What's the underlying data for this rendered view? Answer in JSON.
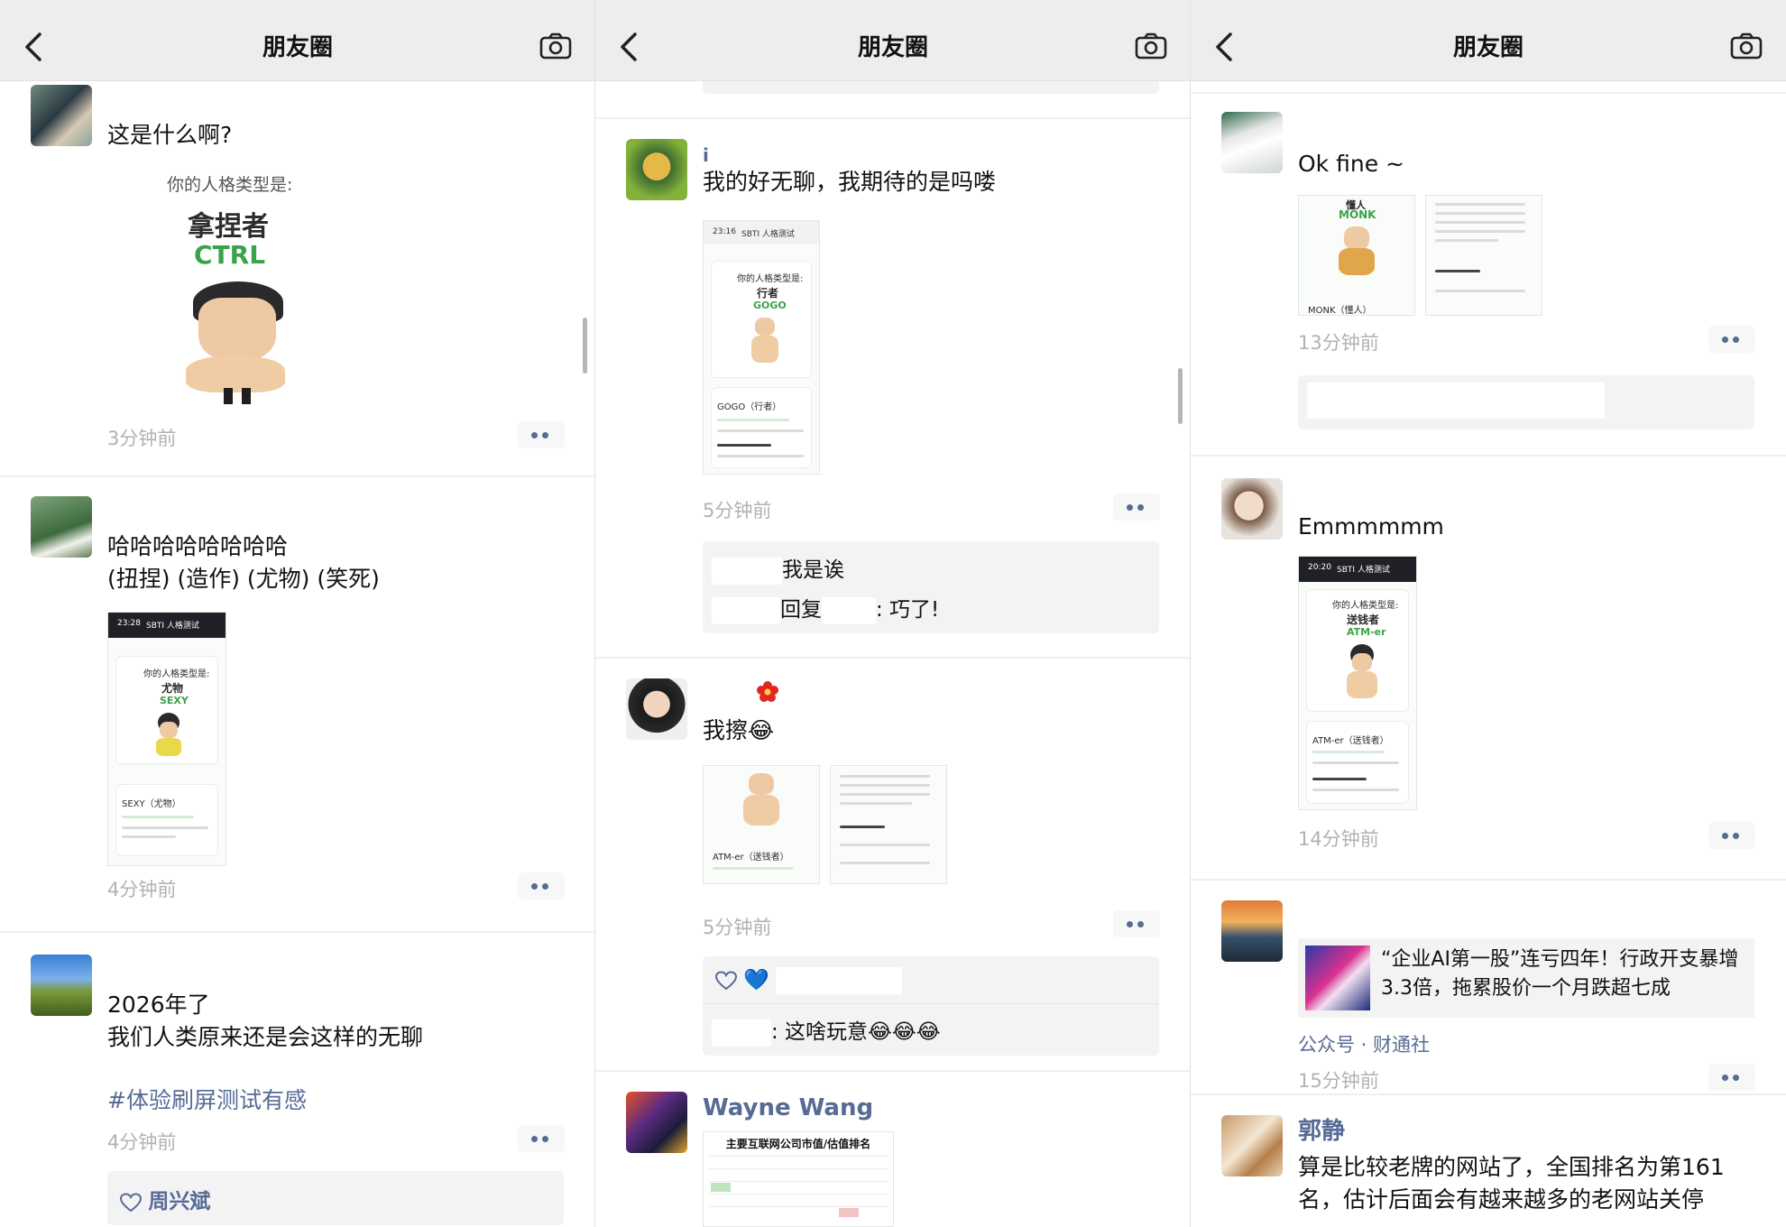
{
  "header": {
    "title": "朋友圈"
  },
  "panel1": {
    "post1": {
      "text": "这是什么啊?",
      "image_subtitle": "你的人格类型是:",
      "image_type_cn": "拿捏者",
      "image_type_en": "CTRL",
      "time": "3分钟前"
    },
    "post2": {
      "text_line1": "哈哈哈哈哈哈哈哈",
      "text_line2": "(扭捏) (造作) (尤物) (笑死)",
      "time": "4分钟前",
      "shot": {
        "status": "23:28",
        "title": "SBTI 人格测试",
        "subtitle": "你的人格类型是:",
        "type_cn": "尤物",
        "type_en": "SEXY",
        "result": "SEXY（尤物）"
      }
    },
    "post3": {
      "text_line1": "2026年了",
      "text_line2": "我们人类原来还是会这样的无聊",
      "hashtag": "#体验刷屏测试有感",
      "time": "4分钟前",
      "like_name": "周兴斌"
    }
  },
  "panel2": {
    "post1": {
      "name": "i",
      "text": "我的好无聊，我期待的是吗喽",
      "time": "5分钟前",
      "shot": {
        "status": "23:16",
        "title": "SBTI 人格测试",
        "subtitle": "你的人格类型是:",
        "type_cn": "行者",
        "type_en": "GOGO",
        "result": "GOGO（行者）"
      },
      "comment1_name": "我是诶",
      "comment2_prefix": "回复",
      "comment2_suffix": ": 巧了!"
    },
    "post2": {
      "text": "我擦😂",
      "time": "5分钟前",
      "shot_result": "ATM-er（送钱者）",
      "like_emoji": "💙",
      "comment_text": ": 这啥玩意😂😂😂"
    },
    "post3": {
      "name": "Wayne Wang",
      "chart_title": "主要互联网公司市值/估值排名"
    }
  },
  "panel3": {
    "post1": {
      "text": "Ok fine ~",
      "shot_type_cn": "懂人",
      "shot_type_en": "MONK",
      "shot_result": "MONK（懂人）",
      "time": "13分钟前"
    },
    "post2": {
      "text": "Emmmmmm",
      "time": "14分钟前",
      "shot": {
        "status": "20:20",
        "title": "SBTI 人格测试",
        "subtitle": "你的人格类型是:",
        "type_cn": "送钱者",
        "type_en": "ATM-er",
        "result": "ATM-er（送钱者）"
      }
    },
    "post3": {
      "link_text": "“企业AI第一股”连亏四年！行政开支暴增3.3倍，拖累股价一个月跌超七成",
      "source": "公众号 · 财通社",
      "time": "15分钟前"
    },
    "post4": {
      "name": "郭静",
      "text_line1": "算是比较老牌的网站了，全国排名为第161",
      "text_line2": "名，估计后面会有越来越多的老网站关停"
    }
  },
  "colors": {
    "link": "#576b95",
    "time": "#b2b2b2",
    "green": "#3aa34a",
    "header_bg": "#ededed"
  }
}
